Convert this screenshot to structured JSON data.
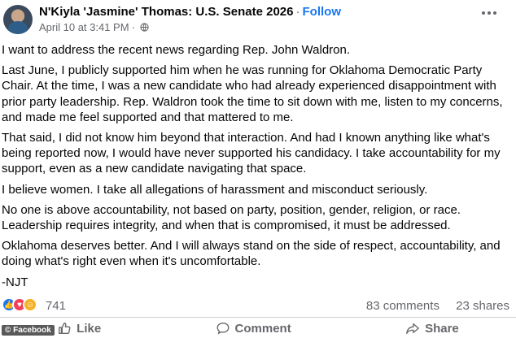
{
  "header": {
    "author": "N'Kiyla 'Jasmine' Thomas: U.S. Senate 2026",
    "separator": "·",
    "follow_label": "Follow",
    "timestamp": "April 10 at 3:41 PM",
    "timestamp_sep": "·",
    "audience_icon": "globe-icon",
    "more_icon": "more-options-icon"
  },
  "post": {
    "paragraphs": [
      "I want to address the recent news regarding Rep. John Waldron.",
      "Last June, I publicly supported him when he was running for Oklahoma Democratic Party Chair. At the time, I was a new candidate who had already experienced disappointment with prior party leadership. Rep. Waldron took the time to sit down with me, listen to my concerns, and made me feel supported and that mattered to me.",
      "That said, I did not know him beyond that interaction. And had I known anything like what's being reported now, I would have never supported his candidacy. I take accountability for my support, even as a new candidate navigating that space.",
      "I believe women. I take all allegations of harassment and misconduct seriously.",
      "No one is above accountability, not based on party, position, gender, religion, or race. Leadership requires integrity, and when that is compromised, it must be addressed.",
      "Oklahoma deserves better. And I will always stand on the side of respect, accountability, and doing what's right even when it's uncomfortable.",
      "-NJT"
    ]
  },
  "reactions": {
    "icons": [
      "like-reaction-icon",
      "love-reaction-icon",
      "care-reaction-icon"
    ],
    "count": "741",
    "comments": "83 comments",
    "shares": "23 shares"
  },
  "actions": {
    "like_label": "Like",
    "comment_label": "Comment",
    "share_label": "Share"
  },
  "watermark": "© Facebook",
  "colors": {
    "accent": "#1877f2",
    "love": "#f33e58",
    "care": "#f7b125",
    "secondary_text": "#65676b"
  }
}
